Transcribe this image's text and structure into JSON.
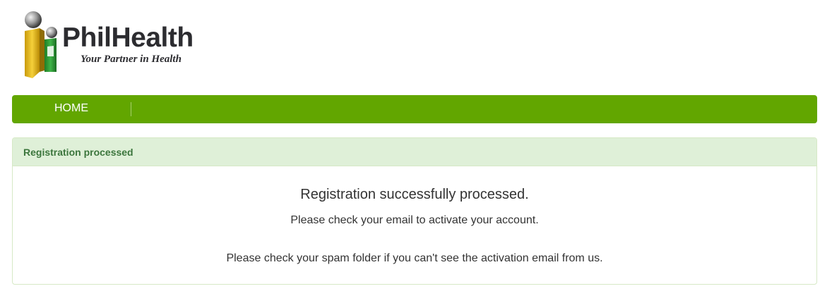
{
  "logo": {
    "name": "PhilHealth",
    "tagline": "Your Partner in Health",
    "colors": {
      "yellow": "#e2b415",
      "green": "#2e9a35",
      "sphere": "#8a8a8a",
      "text": "#2c2c30"
    }
  },
  "nav": {
    "home_label": "HOME",
    "background_color": "#62a600"
  },
  "panel": {
    "heading": "Registration processed",
    "title": "Registration successfully processed.",
    "line1": "Please check your email to activate your account.",
    "line2": "Please check your spam folder if you can't see the activation email from us.",
    "heading_color": "#3c763d",
    "heading_background": "#dff0d8"
  }
}
